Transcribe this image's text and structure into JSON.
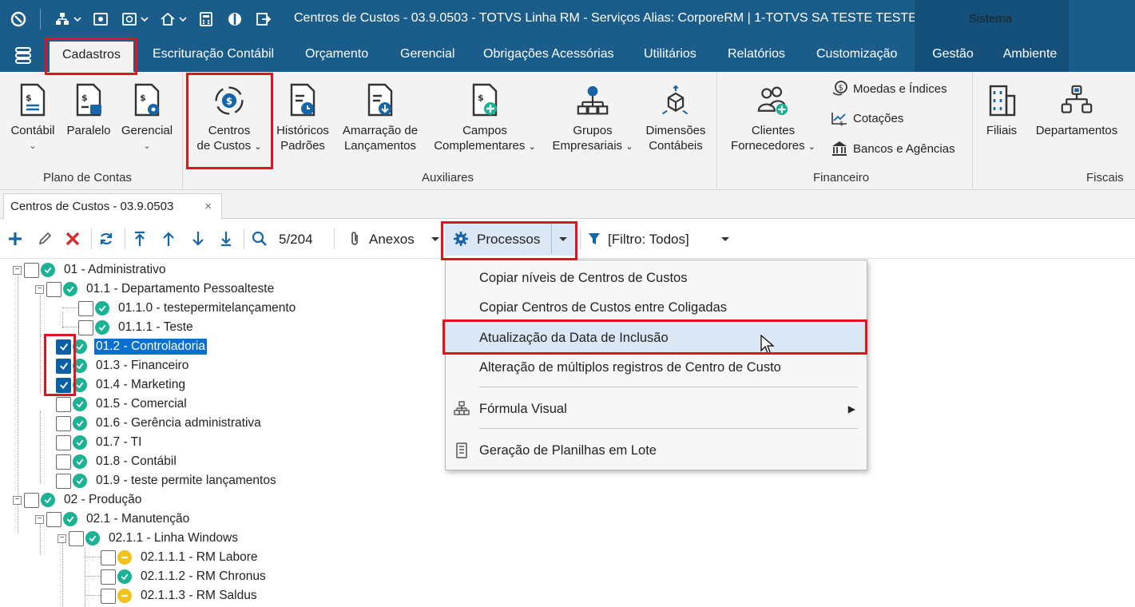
{
  "titlebar": {
    "title": "Centros de Custos - 03.9.0503 - TOTVS Linha RM - Serviços  Alias: CorporeRM | 1-TOTVS SA TESTE TESTE",
    "sistema": "Sistema"
  },
  "menu_tabs": [
    "Cadastros",
    "Escrituração Contábil",
    "Orçamento",
    "Gerencial",
    "Obrigações Acessórias",
    "Utilitários",
    "Relatórios",
    "Customização",
    "Gestão",
    "Ambiente"
  ],
  "ribbon": {
    "contabil": "Contábil",
    "paralelo": "Paralelo",
    "gerencial": "Gerencial",
    "plano_de_contas": "Plano de Contas",
    "centros_l1": "Centros",
    "centros_l2": "de Custos",
    "historicos_l1": "Históricos",
    "historicos_l2": "Padrões",
    "amarracao_l1": "Amarração de",
    "amarracao_l2": "Lançamentos",
    "campos_l1": "Campos",
    "campos_l2": "Complementares",
    "grupos_l1": "Grupos",
    "grupos_l2": "Empresariais",
    "dimensoes_l1": "Dimensões",
    "dimensoes_l2": "Contábeis",
    "auxiliares": "Auxiliares",
    "clientes_l1": "Clientes",
    "clientes_l2": "Fornecedores",
    "moedas": "Moedas e Índices",
    "cotacoes": "Cotações",
    "bancos": "Bancos e Agências",
    "financeiro": "Financeiro",
    "filiais": "Filiais",
    "departamentos": "Departamentos",
    "fiscais": "Fiscais"
  },
  "doc_tab": {
    "label": "Centros de Custos - 03.9.0503",
    "close": "×"
  },
  "toolbar": {
    "counter": "5/204",
    "anexos": "Anexos",
    "processos": "Processos",
    "filtro": "[Filtro: Todos]"
  },
  "tree": [
    {
      "label": "01 - Administrativo",
      "checked": false,
      "status": "ok"
    },
    {
      "label": "01.1 - Departamento Pessoalteste",
      "checked": false,
      "status": "ok"
    },
    {
      "label": "01.1.0 - testepermitelançamento",
      "checked": false,
      "status": "ok"
    },
    {
      "label": "01.1.1 - Teste",
      "checked": false,
      "status": "ok"
    },
    {
      "label": "01.2 - Controladoria",
      "checked": true,
      "status": "ok",
      "selected": true
    },
    {
      "label": "01.3 - Financeiro",
      "checked": true,
      "status": "ok"
    },
    {
      "label": "01.4 - Marketing",
      "checked": true,
      "status": "ok"
    },
    {
      "label": "01.5 - Comercial",
      "checked": false,
      "status": "ok"
    },
    {
      "label": "01.6 - Gerência administrativa",
      "checked": false,
      "status": "ok"
    },
    {
      "label": "01.7 - TI",
      "checked": false,
      "status": "ok"
    },
    {
      "label": "01.8 - Contábil",
      "checked": false,
      "status": "ok"
    },
    {
      "label": "01.9 - teste permite lançamentos",
      "checked": false,
      "status": "ok"
    },
    {
      "label": "02 - Produção",
      "checked": false,
      "status": "ok"
    },
    {
      "label": "02.1 - Manutenção",
      "checked": false,
      "status": "ok"
    },
    {
      "label": "02.1.1 - Linha Windows",
      "checked": false,
      "status": "ok"
    },
    {
      "label": "02.1.1.1 - RM Labore",
      "checked": false,
      "status": "warn"
    },
    {
      "label": "02.1.1.2 - RM Chronus",
      "checked": false,
      "status": "ok"
    },
    {
      "label": "02.1.1.3 - RM Saldus",
      "checked": false,
      "status": "warn"
    }
  ],
  "dropdown": {
    "items": [
      "Copiar níveis de Centros de Custos",
      "Copiar Centros de Custos entre Coligadas",
      "Atualização da Data de Inclusão",
      "Alteração de múltiplos registros de Centro de Custo",
      "Fórmula Visual",
      "Geração de Planilhas em Lote"
    ],
    "submenu_arrow": "▶"
  },
  "colors": {
    "titlebar": "#1a5c8a",
    "accent": "#1565a8",
    "status_ok": "#19b394",
    "status_warn": "#f0c21c",
    "highlight_box": "#e0141e",
    "delete": "#d32f2f"
  }
}
